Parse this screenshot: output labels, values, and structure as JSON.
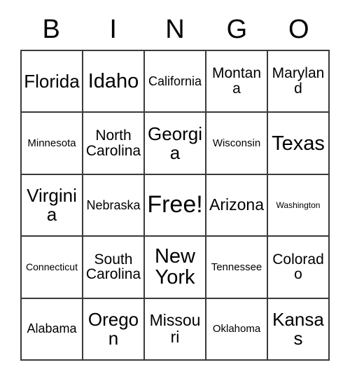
{
  "header": {
    "letters": [
      "B",
      "I",
      "N",
      "G",
      "O"
    ]
  },
  "grid": {
    "rows": 5,
    "columns": 5,
    "border_color": "#3a3a3a",
    "cell_background": "#ffffff",
    "text_color": "#000000",
    "cells": [
      {
        "label": "Florida",
        "size": "2xl"
      },
      {
        "label": "Idaho",
        "size": "3xl"
      },
      {
        "label": "California",
        "size": "m"
      },
      {
        "label": "Montana",
        "size": "l"
      },
      {
        "label": "Maryland",
        "size": "l"
      },
      {
        "label": "Minnesota",
        "size": "s"
      },
      {
        "label": "North Carolina",
        "size": "l"
      },
      {
        "label": "Georgia",
        "size": "2xl"
      },
      {
        "label": "Wisconsin",
        "size": "s"
      },
      {
        "label": "Texas",
        "size": "3xl"
      },
      {
        "label": "Virginia",
        "size": "2xl"
      },
      {
        "label": "Nebraska",
        "size": "m"
      },
      {
        "label": "Free!",
        "size": "4xl"
      },
      {
        "label": "Arizona",
        "size": "xl"
      },
      {
        "label": "Washington",
        "size": "xxs"
      },
      {
        "label": "Connecticut",
        "size": "xs"
      },
      {
        "label": "South Carolina",
        "size": "l"
      },
      {
        "label": "New York",
        "size": "3xl"
      },
      {
        "label": "Tennessee",
        "size": "s"
      },
      {
        "label": "Colorado",
        "size": "l"
      },
      {
        "label": "Alabama",
        "size": "m"
      },
      {
        "label": "Oregon",
        "size": "2xl"
      },
      {
        "label": "Missouri",
        "size": "xl"
      },
      {
        "label": "Oklahoma",
        "size": "s"
      },
      {
        "label": "Kansas",
        "size": "2xl"
      }
    ]
  }
}
